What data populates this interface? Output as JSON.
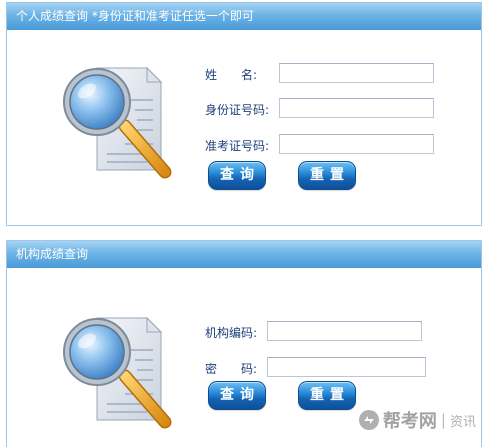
{
  "panel_personal": {
    "title": "个人成绩查询 *身份证和准考证任选一个即可",
    "fields": {
      "name_label": "姓　　名:",
      "id_label": "身份证号码:",
      "exam_label": "准考证号码:"
    },
    "buttons": {
      "query": "查询",
      "reset": "重置"
    }
  },
  "panel_org": {
    "title": "机构成绩查询",
    "fields": {
      "org_code_label": "机构编码:",
      "password_label": "密　　码:"
    },
    "buttons": {
      "query": "查询",
      "reset": "重置"
    }
  },
  "watermark": {
    "brand": "帮考网",
    "separator": "|",
    "sub": "资讯"
  },
  "colors": {
    "header_blue": "#4a9ad8",
    "label_text": "#1f3f7a",
    "button_blue": "#1564b5"
  },
  "icons": [
    "magnifier-document-icon",
    "watermark-logo-icon"
  ]
}
